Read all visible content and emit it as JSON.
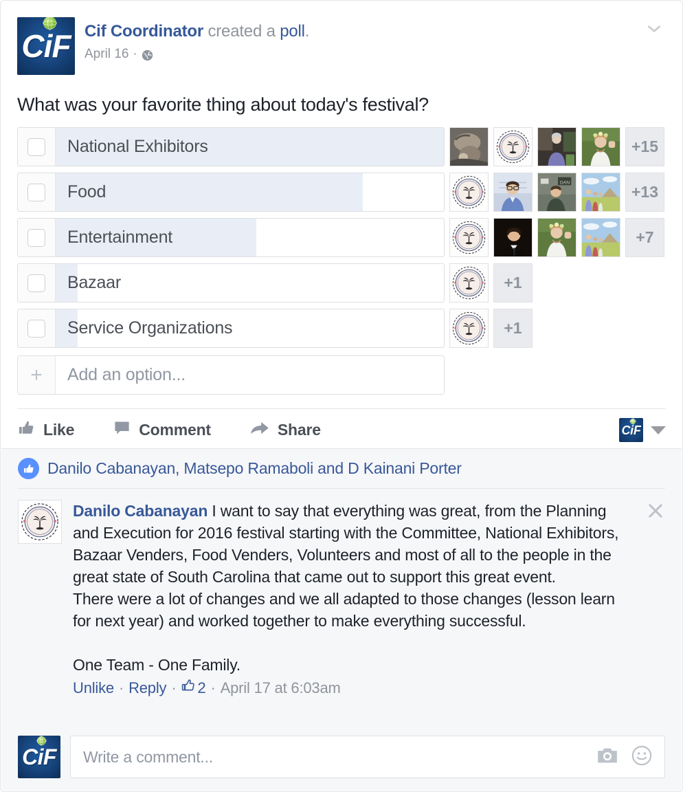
{
  "post": {
    "author": "Cif Coordinator",
    "action_text": " created a ",
    "action_link": "poll",
    "action_suffix": ".",
    "date": "April 16",
    "separator": "·",
    "privacy_icon": "globe-icon",
    "menu_icon": "chevron-down-icon",
    "question": "What was your favorite thing about today's festival?"
  },
  "poll": {
    "options": [
      {
        "label": "National Exhibitors",
        "fill_pct": 100,
        "more": "+15",
        "thumbs": [
          "photo-dog",
          "seal-emblem",
          "photo-woman-purple",
          "photo-woman-flowers"
        ]
      },
      {
        "label": "Food",
        "fill_pct": 81,
        "more": "+13",
        "thumbs": [
          "seal-emblem",
          "photo-man-glasses",
          "photo-man-street",
          "photo-family-pyramid"
        ]
      },
      {
        "label": "Entertainment",
        "fill_pct": 56,
        "more": "+7",
        "thumbs": [
          "seal-emblem",
          "photo-boy-suit",
          "photo-woman-flowers",
          "photo-family-pyramid"
        ]
      },
      {
        "label": "Bazaar",
        "fill_pct": 14,
        "more": "+1",
        "thumbs": [
          "seal-emblem"
        ]
      },
      {
        "label": "Service Organizations",
        "fill_pct": 14,
        "more": "+1",
        "thumbs": [
          "seal-emblem"
        ]
      }
    ],
    "add_option_placeholder": "Add an option...",
    "add_option_icon": "plus-icon"
  },
  "actions": {
    "like": "Like",
    "comment": "Comment",
    "share": "Share",
    "like_icon": "thumbs-up-icon",
    "comment_icon": "speech-bubble-icon",
    "share_icon": "share-arrow-icon",
    "account_picker_icon": "chevron-down-icon"
  },
  "likes": {
    "icon": "thumbs-up-badge-icon",
    "names": "Danilo Cabanayan, Matsepo Ramaboli and D Kainani Porter"
  },
  "comment": {
    "avatar_icon": "seal-emblem",
    "author": "Danilo Cabanayan",
    "body": " I want to say that everything was great, from the Planning and Execution for 2016 festival starting with the Committee, National Exhibitors, Bazaar Venders, Food Venders, Volunteers and most of all to the people in the great state of South Carolina that came out to support this great event.\nThere were a lot of changes and we all adapted to those changes (lesson learn for next year) and worked together to make everything successful.\n\nOne Team - One Family.",
    "unlike": "Unlike",
    "reply": "Reply",
    "like_count": "2",
    "like_count_icon": "thumbs-up-outline-icon",
    "timestamp": "April 17 at 6:03am",
    "close_icon": "close-icon"
  },
  "composer": {
    "placeholder": "Write a comment...",
    "camera_icon": "camera-icon",
    "emoji_icon": "smiley-icon"
  },
  "colors": {
    "link": "#365899",
    "meta": "#90949c",
    "poll_fill": "#e9eef6",
    "brand_blue": "#1a4a87",
    "like_blue": "#5890ff",
    "comment_bg": "#f6f7f9"
  }
}
